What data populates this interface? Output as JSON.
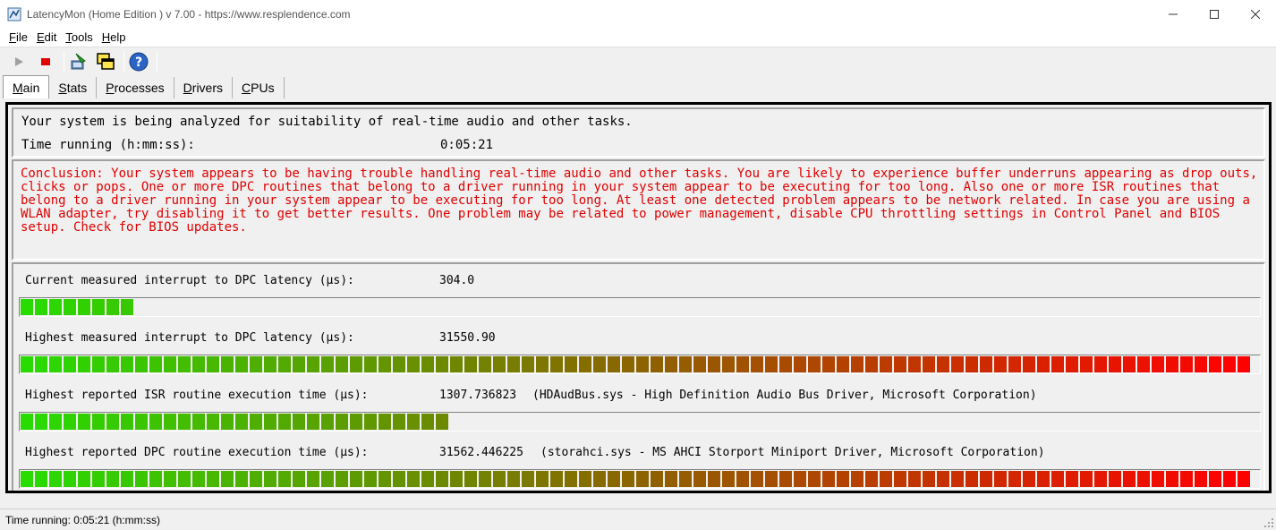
{
  "window": {
    "title": "LatencyMon  (Home Edition )  v 7.00 - https://www.resplendence.com"
  },
  "menu": {
    "items": [
      {
        "key": "F",
        "rest": "ile"
      },
      {
        "key": "E",
        "rest": "dit"
      },
      {
        "key": "T",
        "rest": "ools"
      },
      {
        "key": "H",
        "rest": "elp"
      }
    ]
  },
  "toolbar": {
    "buttons": [
      "play-icon",
      "stop-icon",
      "submit-icon",
      "windows-icon",
      "help-icon"
    ]
  },
  "tabs": [
    {
      "key": "M",
      "rest": "ain",
      "active": true
    },
    {
      "key": "S",
      "rest": "tats",
      "active": false
    },
    {
      "key": "P",
      "rest": "rocesses",
      "active": false
    },
    {
      "key": "D",
      "rest": "rivers",
      "active": false
    },
    {
      "key": "C",
      "rest": "PUs",
      "active": false
    }
  ],
  "summary": {
    "headline": "Your system is being analyzed for suitability of real-time audio and other tasks.",
    "time_label": "Time running (h:mm:ss):",
    "time_value": "0:05:21"
  },
  "conclusion": {
    "text": "Conclusion: Your system appears to be having trouble handling real-time audio and other tasks. You are likely to experience buffer underruns appearing as drop outs, clicks or pops. One or more DPC routines that belong to a driver running in your system appear to be executing for too long. Also one or more ISR routines that belong to a driver running in your system appear to be executing for too long. At least one detected problem appears to be network related. In case you are using a WLAN adapter, try disabling it to get better results. One problem may be related to power management, disable CPU throttling settings in Control Panel and BIOS setup. Check for BIOS updates.",
    "color": "#e00000"
  },
  "metrics": [
    {
      "label": "Current measured interrupt to DPC latency (µs):",
      "value": "304.0",
      "extra": "",
      "fill": 0.09
    },
    {
      "label": "Highest measured interrupt to DPC latency (µs):",
      "value": "31550.90",
      "extra": "",
      "fill": 1.0
    },
    {
      "label": "Highest reported ISR routine execution time (µs):",
      "value": "1307.736823",
      "extra": "(HDAudBus.sys - High Definition Audio Bus Driver, Microsoft Corporation)",
      "fill": 0.345
    },
    {
      "label": "Highest reported DPC routine execution time (µs):",
      "value": "31562.446225",
      "extra": "(storahci.sys - MS AHCI Storport Miniport Driver, Microsoft Corporation)",
      "fill": 1.0
    }
  ],
  "statusbar": {
    "text": "Time running: 0:05:21  (h:mm:ss)"
  }
}
